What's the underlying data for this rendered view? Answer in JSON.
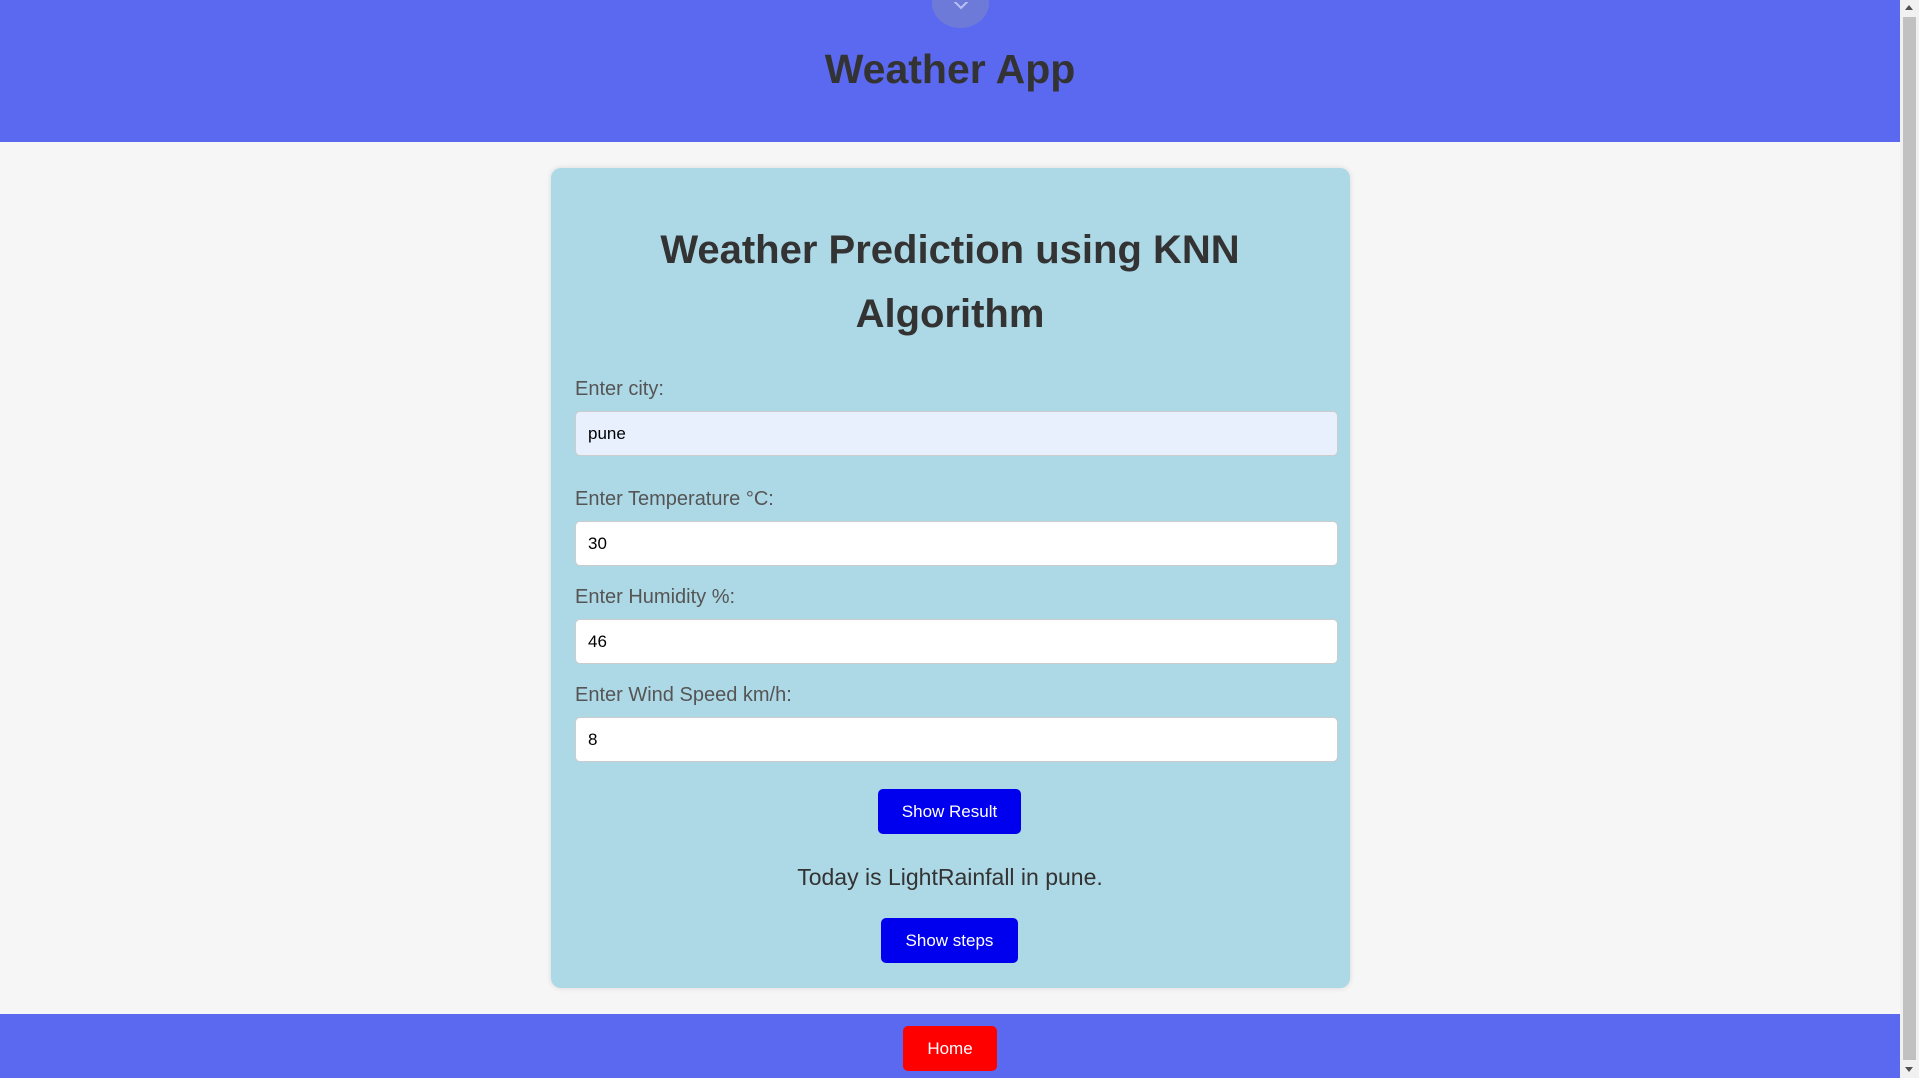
{
  "header": {
    "title": "Weather App",
    "close_icon": "close-icon",
    "background": "#5b69f0"
  },
  "card": {
    "title": "Weather Prediction using KNN Algorithm",
    "background": "#add8e6"
  },
  "form": {
    "city": {
      "label": "Enter city:",
      "value": "pune"
    },
    "temperature": {
      "label": "Enter Temperature °C:",
      "value": "30"
    },
    "humidity": {
      "label": "Enter Humidity %:",
      "value": "46"
    },
    "wind_speed": {
      "label": "Enter Wind Speed km/h:",
      "value": "8"
    }
  },
  "actions": {
    "show_result_label": "Show Result",
    "show_steps_label": "Show steps",
    "button_color": "#0000ee"
  },
  "result": {
    "text": "Today is LightRainfall in pune."
  },
  "footer": {
    "home_label": "Home",
    "home_color": "#ff0000"
  }
}
